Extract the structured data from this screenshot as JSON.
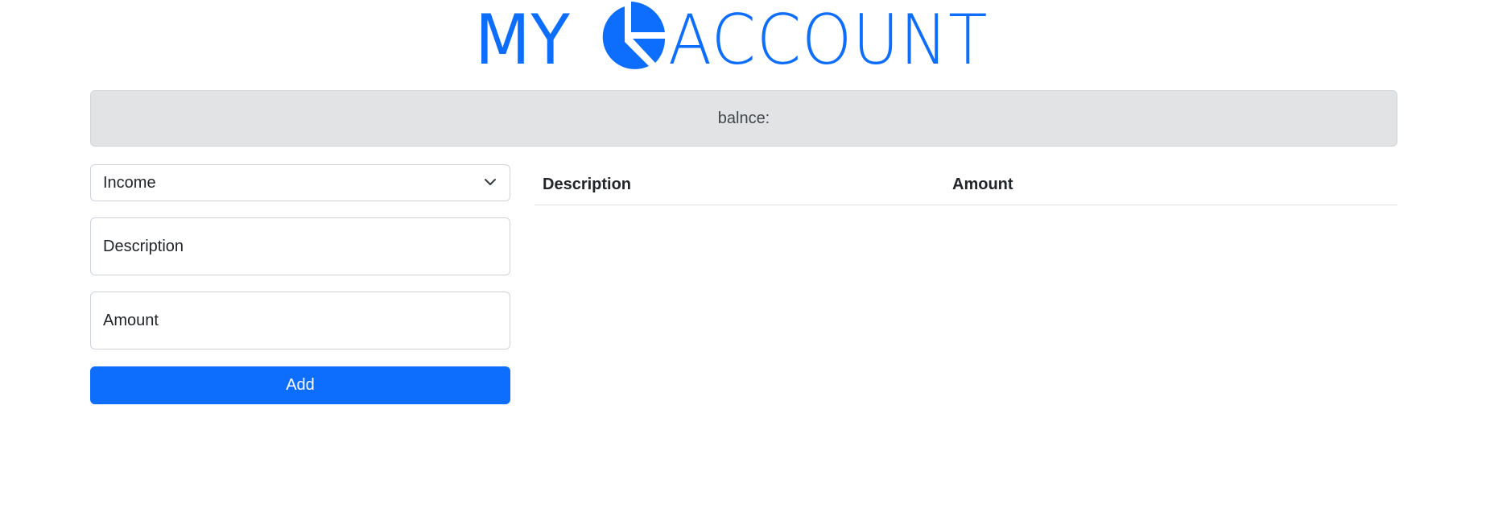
{
  "header": {
    "logo_left": "MY",
    "logo_right": "ACCOUNT",
    "brand_color": "#0d6efd"
  },
  "balance": {
    "label": "balnce:"
  },
  "form": {
    "type_select": {
      "selected": "Income"
    },
    "description": {
      "placeholder": "Description"
    },
    "amount": {
      "placeholder": "Amount"
    },
    "add_label": "Add"
  },
  "table": {
    "columns": [
      "Description",
      "Amount"
    ],
    "rows": []
  }
}
